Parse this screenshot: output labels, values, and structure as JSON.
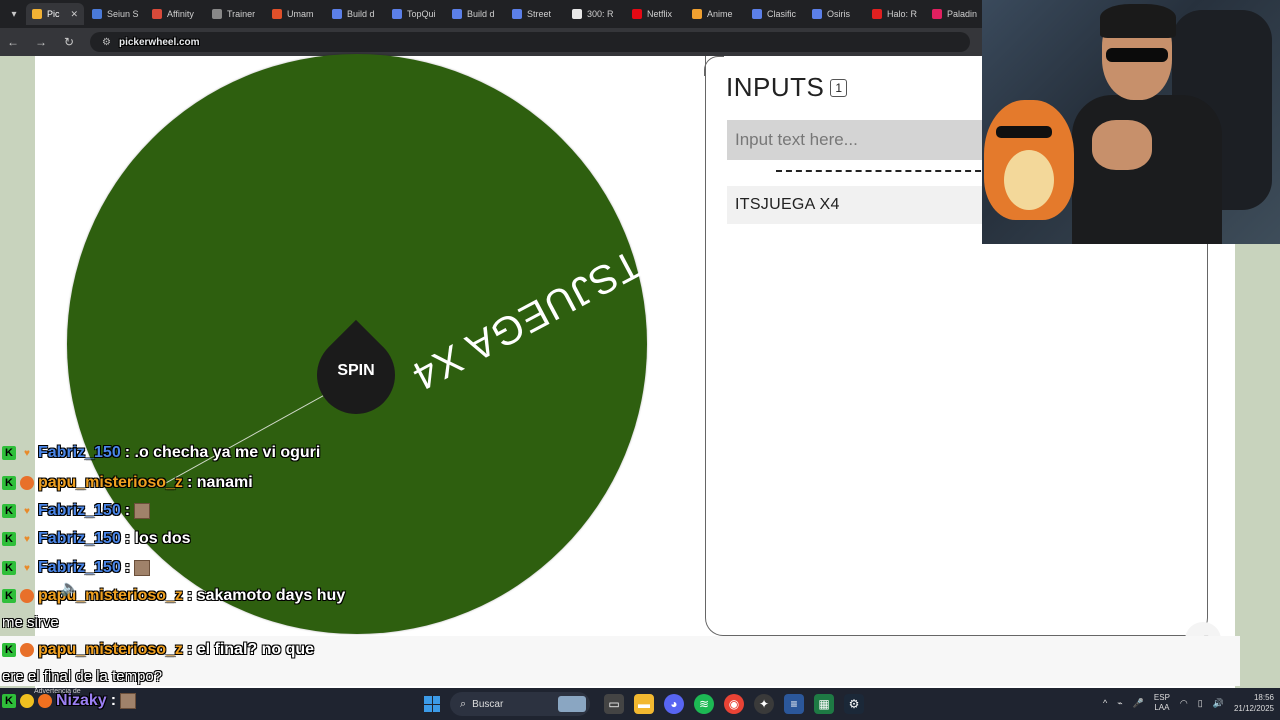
{
  "browser": {
    "tabs": [
      {
        "label": "Pic",
        "color": "#f2b234",
        "active": true
      },
      {
        "label": "Seiun S",
        "color": "#4a7ad9"
      },
      {
        "label": "Affinity",
        "color": "#d94a3a"
      },
      {
        "label": "Trainer",
        "color": "#888888"
      },
      {
        "label": "Umam",
        "color": "#e0502a"
      },
      {
        "label": "Build d",
        "color": "#5b7fe8"
      },
      {
        "label": "TopQui",
        "color": "#5b7fe8"
      },
      {
        "label": "Build d",
        "color": "#5b7fe8"
      },
      {
        "label": "Street",
        "color": "#5b7fe8"
      },
      {
        "label": "300: R",
        "color": "#e8e8e8"
      },
      {
        "label": "Netflix",
        "color": "#e50914"
      },
      {
        "label": "Anime",
        "color": "#f0a030"
      },
      {
        "label": "Clasific",
        "color": "#5b7fe8"
      },
      {
        "label": "Osiris",
        "color": "#5b7fe8"
      },
      {
        "label": "Halo: R",
        "color": "#e02020"
      },
      {
        "label": "Paladin",
        "color": "#e02060"
      }
    ],
    "url": "pickerwheel.com"
  },
  "wheel": {
    "segment_label": "ITSJUEGA X4",
    "color": "#2e5f0f",
    "spin_label": "SPIN"
  },
  "inputs": {
    "title": "INPUTS",
    "count": "1",
    "placeholder": "Input text here...",
    "entries": [
      "ITSJUEGA X4"
    ]
  },
  "chat": {
    "messages": [
      {
        "user": "Fabriz_150",
        "text": ": .o checha ya me vi oguri",
        "color": "blue"
      },
      {
        "user": "papu_misterioso_z",
        "text": ": nanami",
        "color": "orange"
      },
      {
        "user": "Fabriz_150",
        "text": ":",
        "color": "blue",
        "emote": true
      },
      {
        "user": "Fabriz_150",
        "text": ": los dos",
        "color": "blue"
      },
      {
        "user": "Fabriz_150",
        "text": ":",
        "color": "blue",
        "emote": true
      },
      {
        "user": "papu_misterioso_z",
        "text": ": sakamoto days huy",
        "color": "orange"
      },
      {
        "user": "papu_misterioso_z",
        "text": ": el final? no que",
        "color": "orange"
      }
    ],
    "plain": [
      "me sirve",
      "ere el final de la tempo?"
    ],
    "last_user": "Nizaky",
    "last_colon": ":"
  },
  "taskbar": {
    "search_label": "Buscar",
    "tray_lang_1": "ESP",
    "tray_lang_2": "LAA",
    "time": "18:56",
    "date": "21/12/2025",
    "mini_text": "Advertencia de"
  }
}
